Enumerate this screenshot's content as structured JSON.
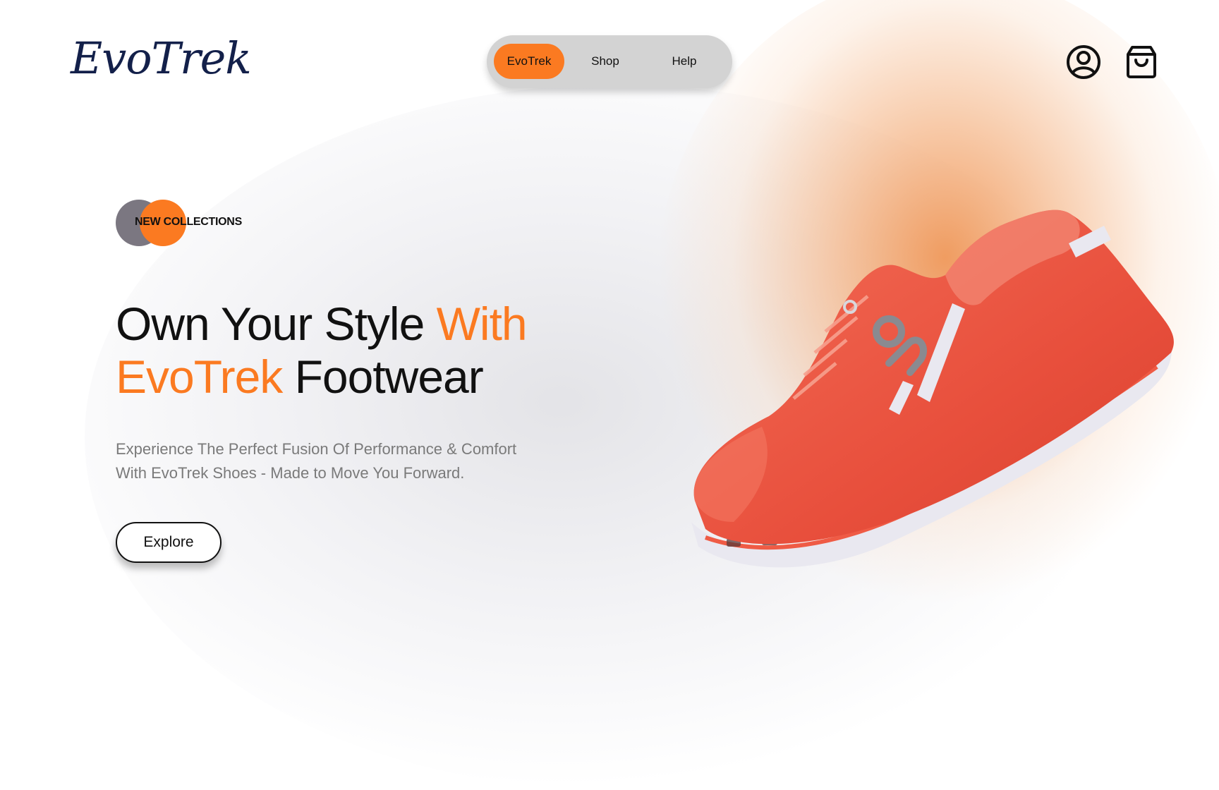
{
  "brand": {
    "logo_text": "EvoTrek"
  },
  "nav": {
    "items": [
      {
        "label": "EvoTrek",
        "active": true
      },
      {
        "label": "Shop",
        "active": false
      },
      {
        "label": "Help",
        "active": false
      }
    ]
  },
  "header_icons": {
    "account": "user-circle-icon",
    "cart": "shopping-bag-icon"
  },
  "hero": {
    "badge": "NEW COLLECTIONS",
    "headline": {
      "part1": "Own Your Style ",
      "part2_accent": "With",
      "part3_accent": "EvoTrek",
      "part4": " Footwear"
    },
    "subtext_line1": "Experience The Perfect Fusion Of Performance & Comfort",
    "subtext_line2": "With EvoTrek Shoes - Made to Move You Forward.",
    "cta_label": "Explore"
  },
  "colors": {
    "accent": "#fb7a21",
    "badge_gray": "#7b7781",
    "nav_bg": "#d3d3d3",
    "logo": "#13204a",
    "subtext": "#7a7a7a",
    "shoe_upper": "#ef5b45",
    "shoe_sole": "#e9e8f0"
  }
}
